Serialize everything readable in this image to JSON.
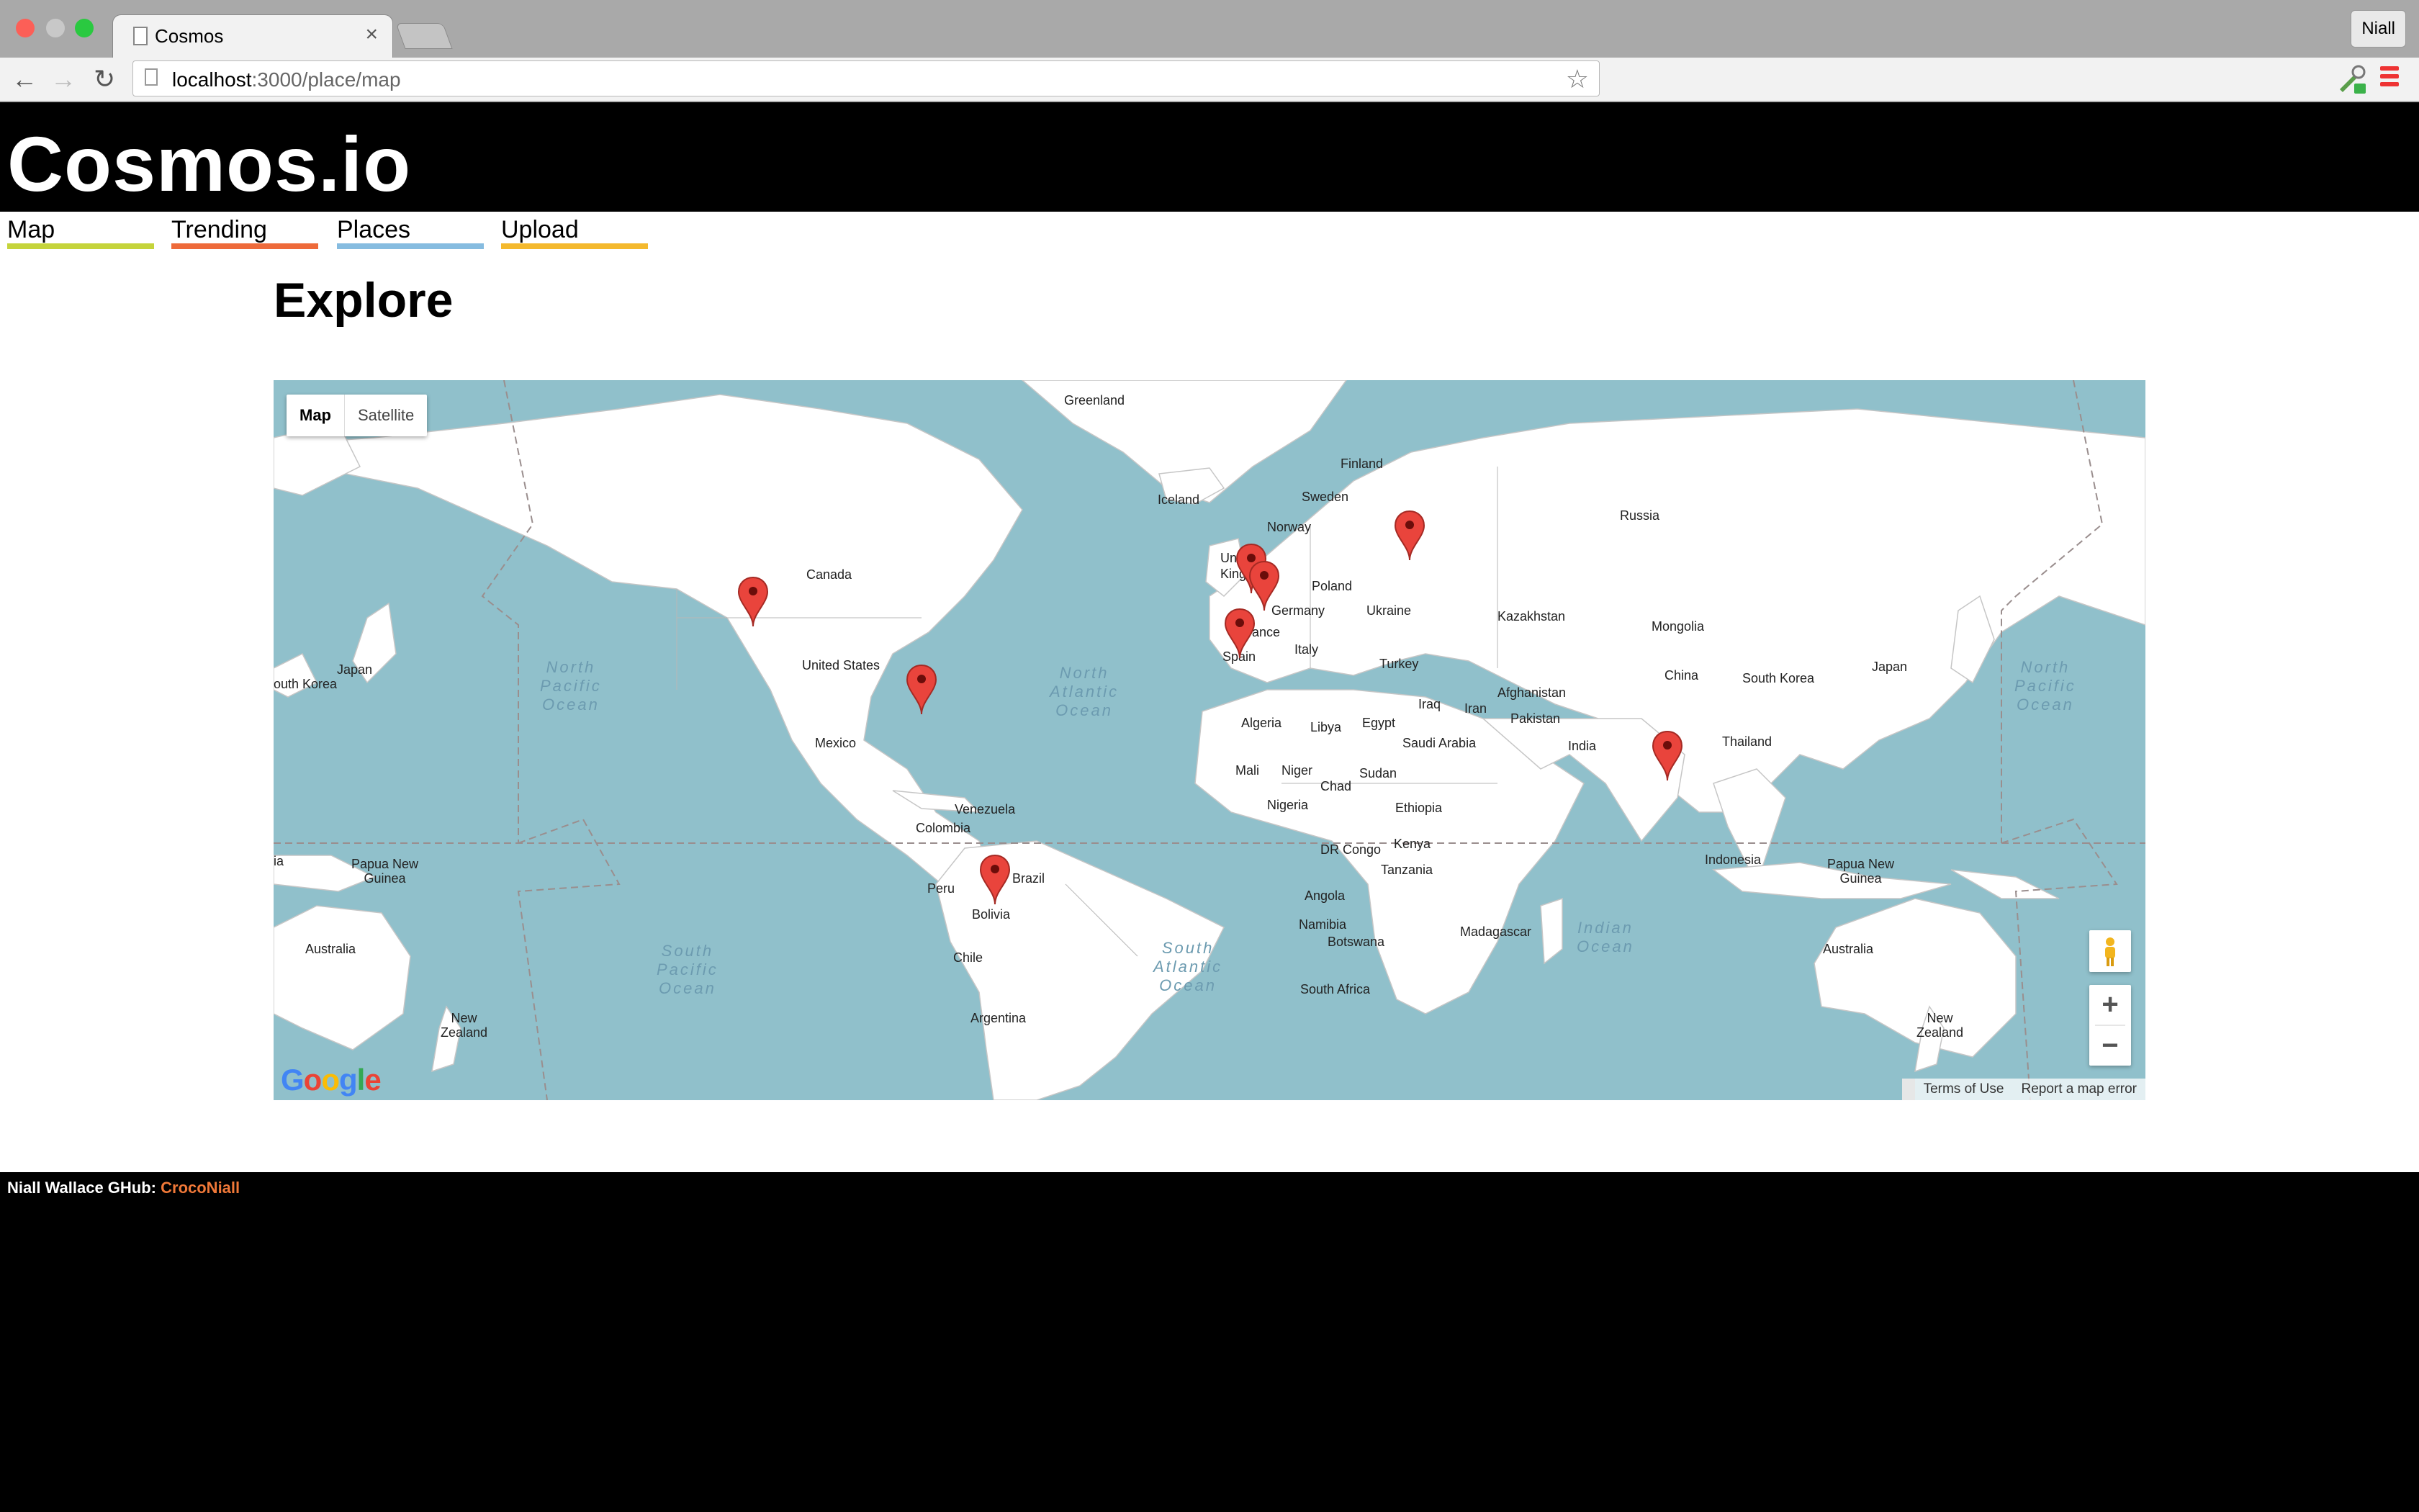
{
  "browser": {
    "tab_title": "Cosmos",
    "tab_close": "×",
    "profile_name": "Niall",
    "url_host": "localhost",
    "url_rest": ":3000/place/map",
    "back": "←",
    "forward": "→",
    "reload": "↻",
    "star": "☆"
  },
  "site": {
    "logo": "Cosmos.io",
    "nav": [
      {
        "label": "Map",
        "color": "#c5d43b"
      },
      {
        "label": "Trending",
        "color": "#ee6a3a"
      },
      {
        "label": "Places",
        "color": "#86bce0"
      },
      {
        "label": "Upload",
        "color": "#f4b92e"
      }
    ],
    "page_heading": "Explore"
  },
  "map": {
    "type_buttons": [
      "Map",
      "Satellite"
    ],
    "active_type": "Map",
    "zoom_in": "+",
    "zoom_out": "−",
    "attribution": [
      "Terms of Use",
      "Report a map error"
    ],
    "labels": {
      "greenland": "Greenland",
      "iceland": "Iceland",
      "finland": "Finland",
      "sweden": "Sweden",
      "norway": "Norway",
      "russia": "Russia",
      "united_kingdom": "United Kingdom",
      "poland": "Poland",
      "germany": "Germany",
      "ukraine": "Ukraine",
      "france": "France",
      "kazakhstan": "Kazakhstan",
      "mongolia": "Mongolia",
      "spain": "Spain",
      "italy": "Italy",
      "turkey": "Turkey",
      "china": "China",
      "south_korea_e": "South Korea",
      "japan_e": "Japan",
      "canada": "Canada",
      "united_states": "United States",
      "mexico": "Mexico",
      "japan_w": "Japan",
      "south_korea_w": "outh Korea",
      "afghanistan": "Afghanistan",
      "iraq": "Iraq",
      "iran": "Iran",
      "pakistan": "Pakistan",
      "algeria": "Algeria",
      "libya": "Libya",
      "egypt": "Egypt",
      "saudi_arabia": "Saudi Arabia",
      "india": "India",
      "thailand": "Thailand",
      "mali": "Mali",
      "niger": "Niger",
      "sudan": "Sudan",
      "chad": "Chad",
      "nigeria": "Nigeria",
      "ethiopia": "Ethiopia",
      "venezuela": "Venezuela",
      "colombia": "Colombia",
      "dr_congo": "DR Congo",
      "kenya": "Kenya",
      "indonesia": "Indonesia",
      "png_w": "Papua New\nGuinea",
      "png_e": "Papua New\nGuinea",
      "peru": "Peru",
      "brazil": "Brazil",
      "bolivia": "Bolivia",
      "tanzania": "Tanzania",
      "angola": "Angola",
      "namibia": "Namibia",
      "botswana": "Botswana",
      "madagascar": "Madagascar",
      "chile": "Chile",
      "argentina": "Argentina",
      "south_africa": "South Africa",
      "australia_w": "Australia",
      "australia_e": "Australia",
      "new_zealand_w": "New\nZealand",
      "new_zealand_e": "New\nZealand",
      "ia": "ia"
    },
    "oceans": {
      "north_pacific_w": "North\nPacific\nOcean",
      "north_atlantic": "North\nAtlantic\nOcean",
      "north_pacific_e": "North\nPacific\nOcean",
      "south_pacific": "South\nPacific\nOcean",
      "south_atlantic": "South\nAtlantic\nOcean",
      "indian": "Indian\nOcean"
    },
    "markers": [
      "Seattle",
      "Atlanta",
      "Bolivia",
      "Spain",
      "United Kingdom",
      "Germany",
      "Russia",
      "Thailand"
    ]
  },
  "footer": {
    "text": "Niall Wallace GHub: ",
    "github_user": "CrocoNiall"
  }
}
